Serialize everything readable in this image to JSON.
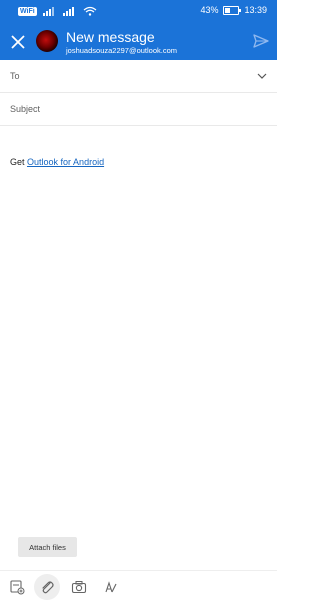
{
  "status": {
    "left_badge": "WiFi",
    "battery": "43%",
    "time": "13:39",
    "battery_level": 0.43
  },
  "header": {
    "title": "New message",
    "account": "joshuadsouza2297@outlook.com",
    "icons": {
      "close": "close-icon",
      "avatar": "avatar",
      "send": "send-icon"
    }
  },
  "fields": {
    "to_label": "To",
    "subject_label": "Subject"
  },
  "body": {
    "prefix": "Get",
    "link_text": "Outlook for Android"
  },
  "attach_chip": "Attach files",
  "toolbar": {
    "items": [
      "attach-file-icon",
      "paperclip-icon",
      "camera-icon",
      "pen-icon"
    ]
  },
  "colors": {
    "accent": "#1b73d8",
    "link": "#1565c0"
  }
}
